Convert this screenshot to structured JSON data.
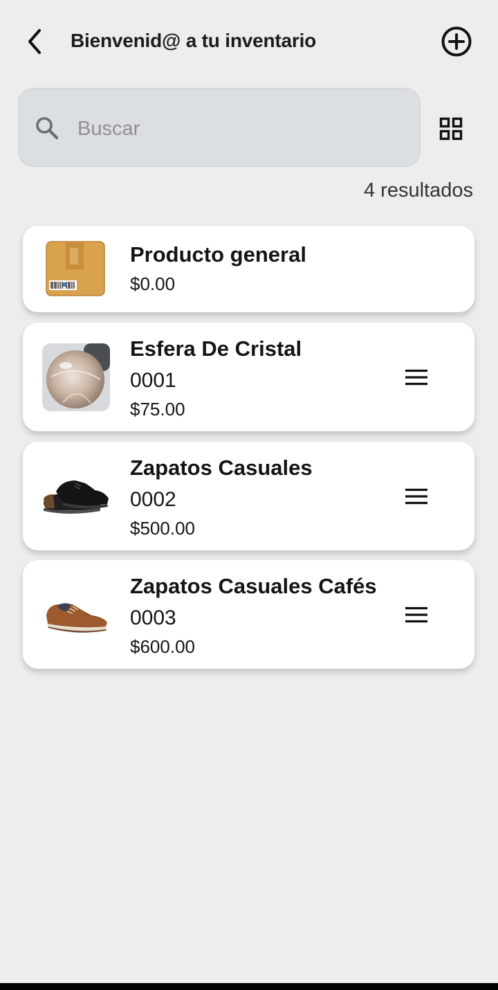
{
  "header": {
    "title": "Bienvenid@ a tu inventario",
    "back_icon": "chevron-left-icon",
    "add_icon": "plus-circle-icon"
  },
  "search": {
    "placeholder": "Buscar",
    "value": "",
    "icon": "search-icon",
    "view_toggle_icon": "grid-view-icon"
  },
  "results": {
    "count_label": "4 resultados"
  },
  "products": [
    {
      "name": "Producto general",
      "code": "",
      "price": "$0.00",
      "image": "box-icon"
    },
    {
      "name": "Esfera De Cristal",
      "code": "0001",
      "price": "$75.00",
      "image": "crystal-ball-photo"
    },
    {
      "name": "Zapatos Casuales",
      "code": "0002",
      "price": "$500.00",
      "image": "black-shoe-photo"
    },
    {
      "name": "Zapatos Casuales Cafés",
      "code": "0003",
      "price": "$600.00",
      "image": "brown-shoe-photo"
    }
  ],
  "colors": {
    "background": "#ededed",
    "search_bg": "#dcdfe2",
    "card_bg": "#ffffff",
    "text": "#141414",
    "placeholder": "#8e9092"
  }
}
